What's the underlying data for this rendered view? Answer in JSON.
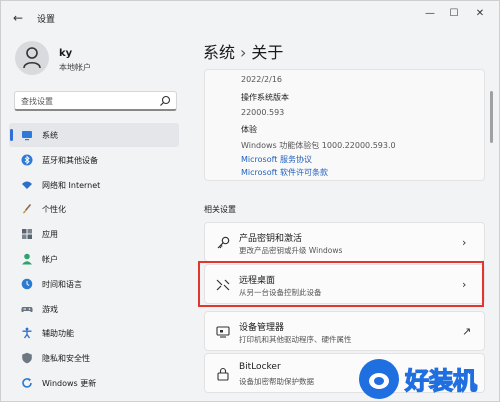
{
  "titlebar": {
    "app_title": "设置",
    "back": "←",
    "minimize": "—",
    "maximize": "☐",
    "close": "✕"
  },
  "profile": {
    "name": "ky",
    "subtitle": "本地帐户"
  },
  "search": {
    "placeholder": "查找设置"
  },
  "nav": {
    "items": [
      {
        "label": "系统",
        "icon": "monitor-icon",
        "active": true
      },
      {
        "label": "蓝牙和其他设备",
        "icon": "bluetooth-icon"
      },
      {
        "label": "网络和 Internet",
        "icon": "wifi-icon"
      },
      {
        "label": "个性化",
        "icon": "brush-icon"
      },
      {
        "label": "应用",
        "icon": "apps-icon"
      },
      {
        "label": "帐户",
        "icon": "person-icon"
      },
      {
        "label": "时间和语言",
        "icon": "globe-clock-icon"
      },
      {
        "label": "游戏",
        "icon": "gamepad-icon"
      },
      {
        "label": "辅助功能",
        "icon": "accessibility-icon"
      },
      {
        "label": "隐私和安全性",
        "icon": "shield-icon"
      },
      {
        "label": "Windows 更新",
        "icon": "windows-update-icon"
      }
    ]
  },
  "breadcrumb": {
    "parent": "系统",
    "separator": "›",
    "current": "关于"
  },
  "info": {
    "date": "2022/2/16",
    "os_build_label": "操作系统版本",
    "os_build_value": "22000.593",
    "experience_label": "体验",
    "experience_value": "Windows 功能体验包 1000.22000.593.0",
    "link_service": "Microsoft 服务协议",
    "link_license": "Microsoft 软件许可条款"
  },
  "related": {
    "title": "相关设置",
    "items": [
      {
        "title": "产品密钥和激活",
        "desc": "更改产品密钥或升级 Windows",
        "icon": "key-icon",
        "action": "›"
      },
      {
        "title": "远程桌面",
        "desc": "从另一台设备控制此设备",
        "icon": "remote-desktop-icon",
        "action": "›"
      },
      {
        "title": "设备管理器",
        "desc": "打印机和其他驱动程序、硬件属性",
        "icon": "device-manager-icon",
        "action": "↗"
      },
      {
        "title": "BitLocker",
        "desc": "设备加密帮助保护数据",
        "icon": "bitlocker-icon",
        "action": "↗"
      }
    ]
  },
  "watermark": {
    "text": "好装机"
  },
  "colors": {
    "accent": "#2f6fd6",
    "link": "#1f5fbf",
    "highlight": "#e3342f"
  }
}
